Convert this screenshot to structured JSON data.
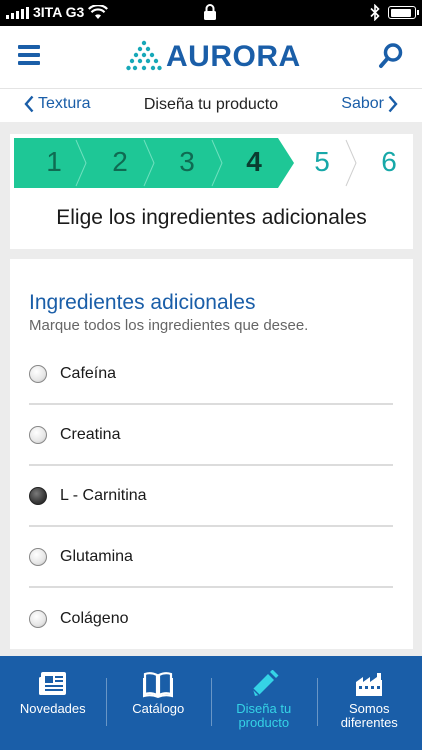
{
  "status_bar": {
    "carrier": "3ITA G3",
    "signal_bars": 5,
    "battery_level": 0.9
  },
  "header": {
    "logo_text": "AURORA",
    "menu_icon": "hamburger-icon",
    "search_icon": "search-icon"
  },
  "subnav": {
    "back_label": "Textura",
    "title": "Diseña tu producto",
    "next_label": "Sabor"
  },
  "steps": {
    "items": [
      "1",
      "2",
      "3",
      "4",
      "5",
      "6"
    ],
    "current": 4,
    "heading": "Elige los ingredientes adicionales",
    "colors": {
      "completed": "#1ec796",
      "pending_text": "#17a8a8"
    }
  },
  "ingredients": {
    "title": "Ingredientes adicionales",
    "subtitle": "Marque todos los ingredientes que desee.",
    "items": [
      {
        "label": "Cafeína",
        "checked": false
      },
      {
        "label": "Creatina",
        "checked": false
      },
      {
        "label": "L - Carnitina",
        "checked": true
      },
      {
        "label": "Glutamina",
        "checked": false
      },
      {
        "label": "Colágeno",
        "checked": false
      }
    ]
  },
  "tabbar": {
    "colors": {
      "background": "#1a5ea8",
      "active": "#35d3e6"
    },
    "tabs": [
      {
        "label": "Novedades",
        "icon": "newspaper-icon",
        "active": false
      },
      {
        "label": "Catálogo",
        "icon": "book-icon",
        "active": false
      },
      {
        "label": "Diseña tu producto",
        "icon": "pencil-icon",
        "active": true
      },
      {
        "label": "Somos diferentes",
        "icon": "factory-icon",
        "active": false
      }
    ]
  }
}
